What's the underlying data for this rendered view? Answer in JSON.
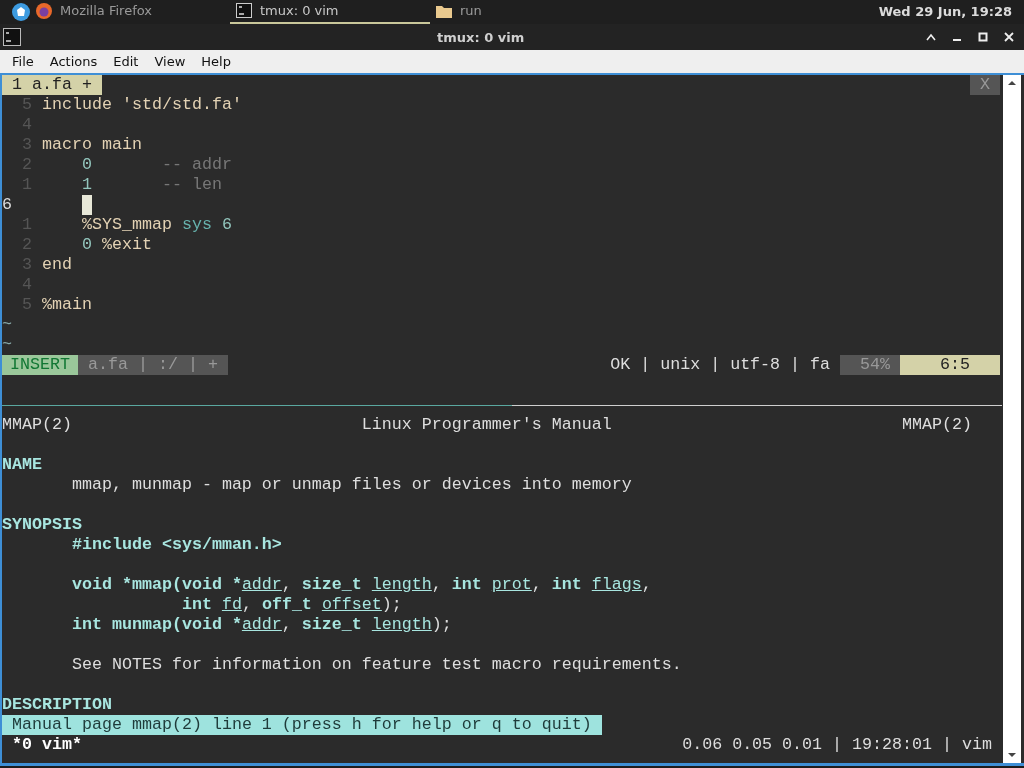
{
  "taskbar": {
    "tasks": [
      {
        "label": "Mozilla Firefox",
        "selected": false
      },
      {
        "label": "tmux: 0 vim",
        "selected": true
      },
      {
        "label": "run",
        "selected": false
      }
    ],
    "clock": "Wed 29 Jun, 19:28"
  },
  "window": {
    "title": "tmux: 0 vim"
  },
  "menu": [
    "File",
    "Actions",
    "Edit",
    "View",
    "Help"
  ],
  "vim": {
    "tabs": [
      {
        "label": "1 a.fa +",
        "selected": true
      }
    ],
    "close_label": "X",
    "lines": [
      {
        "number": "5",
        "current": false,
        "indent": false,
        "segments": [
          {
            "kind": "keyword",
            "text": "include "
          },
          {
            "kind": "string",
            "text": "'std/std.fa'"
          }
        ]
      },
      {
        "number": "4",
        "current": false
      },
      {
        "number": "3",
        "current": false,
        "indent": false,
        "segments": [
          {
            "kind": "keyword",
            "text": "macro main"
          }
        ]
      },
      {
        "number": "2",
        "current": false,
        "indent": true,
        "segments": [
          {
            "kind": "number",
            "text": "0"
          },
          {
            "kind": "comment",
            "text": "       -- addr"
          }
        ]
      },
      {
        "number": "1",
        "current": false,
        "indent": true,
        "segments": [
          {
            "kind": "number",
            "text": "1"
          },
          {
            "kind": "comment",
            "text": "       -- len"
          }
        ]
      },
      {
        "number": "6",
        "current": true,
        "indent": true,
        "cursor": true
      },
      {
        "number": "1",
        "current": false,
        "indent": true,
        "segments": [
          {
            "kind": "plain",
            "text": "%SYS_mmap "
          },
          {
            "kind": "builtin",
            "text": "sys"
          },
          {
            "kind": "number",
            "text": " 6"
          }
        ]
      },
      {
        "number": "2",
        "current": false,
        "indent": true,
        "segments": [
          {
            "kind": "number",
            "text": "0"
          },
          {
            "kind": "plain",
            "text": " %exit"
          }
        ]
      },
      {
        "number": "3",
        "current": false,
        "indent": false,
        "segments": [
          {
            "kind": "keyword",
            "text": "end"
          }
        ]
      },
      {
        "number": "4",
        "current": false
      },
      {
        "number": "5",
        "current": false,
        "indent": false,
        "segments": [
          {
            "kind": "plain",
            "text": "%main"
          }
        ]
      }
    ],
    "tildes": [
      "~",
      "~"
    ],
    "statusline": {
      "mode": "INSERT",
      "file_info": "a.fa | :/ | +",
      "file_status": "OK | unix | utf-8 | fa",
      "percent": "54%",
      "position": "6:5"
    }
  },
  "man": {
    "header": {
      "left": "MMAP(2)",
      "center": "Linux Programmer's Manual",
      "right": "MMAP(2)"
    },
    "lines": [
      {
        "kind": "blank"
      },
      {
        "kind": "heading",
        "segments": [
          {
            "kind": "bold",
            "text": "NAME"
          }
        ]
      },
      {
        "kind": "body",
        "segments": [
          {
            "kind": "plain",
            "text": "mmap, munmap - map or unmap files or devices into memory"
          }
        ]
      },
      {
        "kind": "blank"
      },
      {
        "kind": "heading",
        "segments": [
          {
            "kind": "bold",
            "text": "SYNOPSIS"
          }
        ]
      },
      {
        "kind": "body",
        "segments": [
          {
            "kind": "bold",
            "text": "#include <sys/mman.h>"
          }
        ]
      },
      {
        "kind": "blank"
      },
      {
        "kind": "body",
        "segments": [
          {
            "kind": "bold",
            "text": "void *mmap(void *"
          },
          {
            "kind": "underline",
            "text": "addr"
          },
          {
            "kind": "plain",
            "text": ", "
          },
          {
            "kind": "bold",
            "text": "size_t "
          },
          {
            "kind": "underline",
            "text": "length"
          },
          {
            "kind": "plain",
            "text": ", "
          },
          {
            "kind": "bold",
            "text": "int "
          },
          {
            "kind": "underline",
            "text": "prot"
          },
          {
            "kind": "plain",
            "text": ", "
          },
          {
            "kind": "bold",
            "text": "int "
          },
          {
            "kind": "underline",
            "text": "flags"
          },
          {
            "kind": "plain",
            "text": ","
          }
        ]
      },
      {
        "kind": "continuation",
        "segments": [
          {
            "kind": "bold",
            "text": "int "
          },
          {
            "kind": "underline",
            "text": "fd"
          },
          {
            "kind": "plain",
            "text": ", "
          },
          {
            "kind": "bold",
            "text": "off_t "
          },
          {
            "kind": "underline",
            "text": "offset"
          },
          {
            "kind": "plain",
            "text": ");"
          }
        ]
      },
      {
        "kind": "body",
        "segments": [
          {
            "kind": "bold",
            "text": "int munmap(void *"
          },
          {
            "kind": "underline",
            "text": "addr"
          },
          {
            "kind": "plain",
            "text": ", "
          },
          {
            "kind": "bold",
            "text": "size_t "
          },
          {
            "kind": "underline",
            "text": "length"
          },
          {
            "kind": "plain",
            "text": ");"
          }
        ]
      },
      {
        "kind": "blank"
      },
      {
        "kind": "body",
        "segments": [
          {
            "kind": "plain",
            "text": "See NOTES for information on feature test macro requirements."
          }
        ]
      },
      {
        "kind": "blank"
      },
      {
        "kind": "heading",
        "segments": [
          {
            "kind": "bold",
            "text": "DESCRIPTION"
          }
        ]
      }
    ],
    "prompt": "Manual page mmap(2) line 1 (press h for help or q to quit)"
  },
  "tmux": {
    "window": "*0 vim*",
    "status": "0.06 0.05 0.01 | 19:28:01 | vim"
  }
}
